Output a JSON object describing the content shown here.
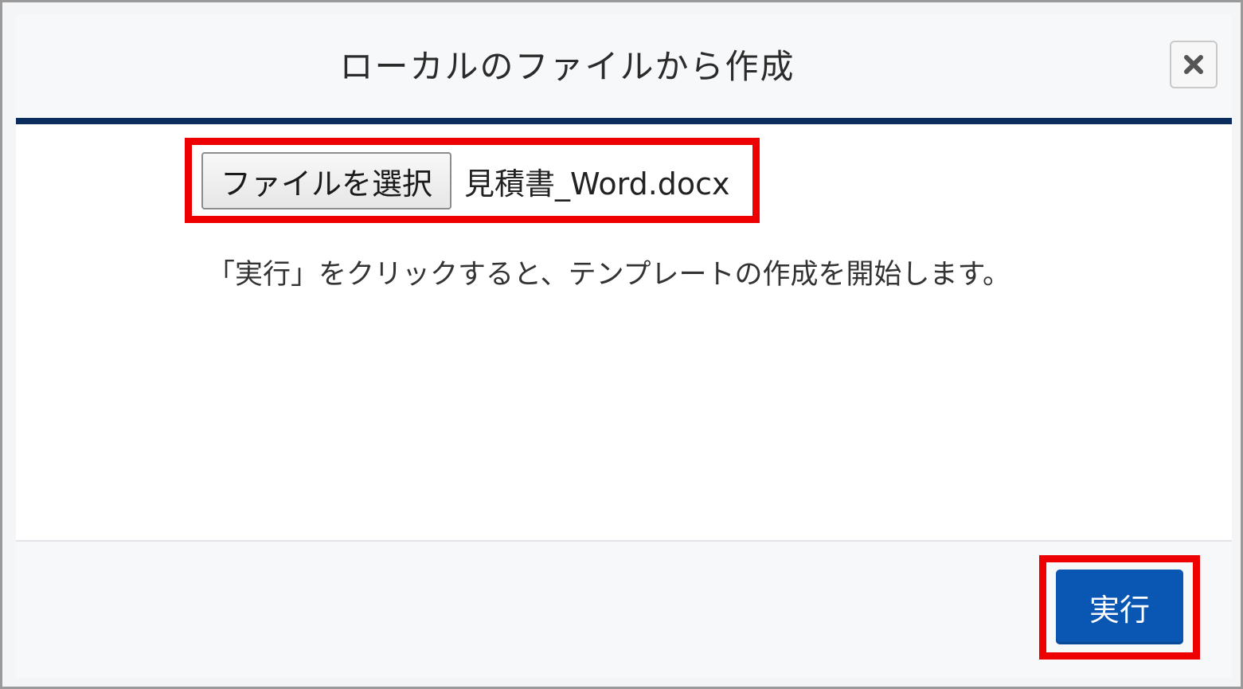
{
  "dialog": {
    "title": "ローカルのファイルから作成",
    "close_icon": "close-icon"
  },
  "file_input": {
    "button_label": "ファイルを選択",
    "selected_file": "見積書_Word.docx"
  },
  "instruction": "「実行」をクリックすると、テンプレートの作成を開始します。",
  "footer": {
    "run_label": "実行"
  },
  "colors": {
    "header_rule": "#0b2d5e",
    "primary_button": "#0a56b3",
    "highlight": "#ee0000"
  }
}
